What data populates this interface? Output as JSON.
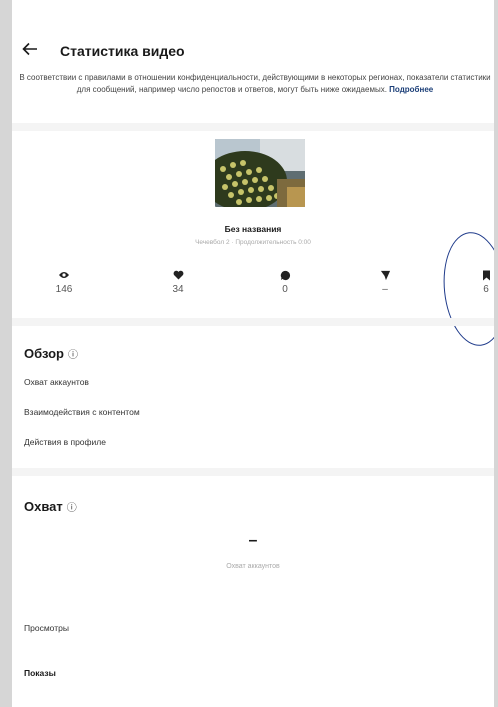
{
  "header": {
    "title": "Статистика видео"
  },
  "notice": {
    "text": "В соответствии с правилами в отношении конфиденциальности, действующими в некоторых регионах, показатели статистики для сообщений, например число репостов и ответов, могут быть ниже ожидаемых.",
    "link": "Подробнее"
  },
  "post": {
    "title": "Без названия",
    "meta": "Чечевбол 2 · Продолжительность 0:00"
  },
  "stats": [
    {
      "icon": "eye-icon",
      "value": "146"
    },
    {
      "icon": "heart-icon",
      "value": "34"
    },
    {
      "icon": "comment-icon",
      "value": "0"
    },
    {
      "icon": "send-icon",
      "value": "–"
    },
    {
      "icon": "bookmark-icon",
      "value": "6"
    }
  ],
  "overview": {
    "title": "Обзор",
    "items": [
      "Охват аккаунтов",
      "Взаимодействия с контентом",
      "Действия в профиле"
    ]
  },
  "reach": {
    "title": "Охват",
    "value": "–",
    "subtitle": "Охват аккаунтов",
    "rows": [
      "Просмотры",
      "Показы"
    ]
  },
  "colors": {
    "annotation": "#1e3a8a",
    "link": "#1c3f78"
  }
}
